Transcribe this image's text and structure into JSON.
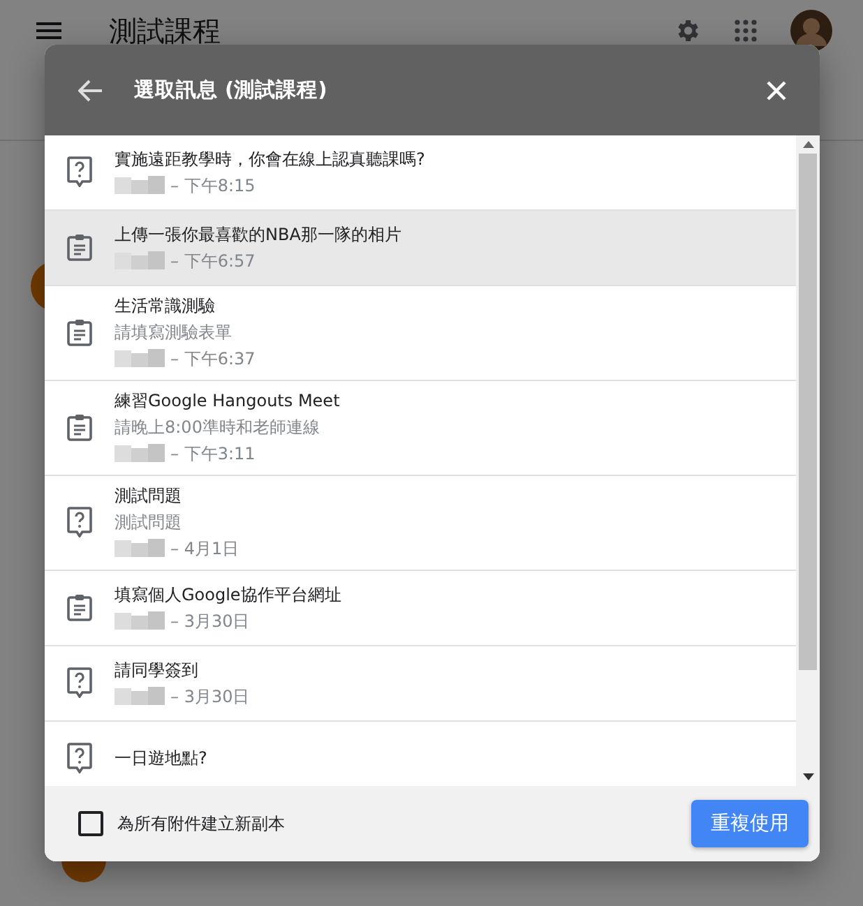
{
  "page": {
    "title": "測試課程"
  },
  "dialog": {
    "title": "選取訊息 (測試課程)",
    "items": [
      {
        "kind": "question",
        "title": "實施遠距教學時，你會在線上認真聽課嗎?",
        "time": "– 下午8:15",
        "selected": false
      },
      {
        "kind": "assignment",
        "title": "上傳一張你最喜歡的NBA那一隊的相片",
        "time": "– 下午6:57",
        "selected": true
      },
      {
        "kind": "assignment",
        "title": "生活常識測驗",
        "subtitle": "請填寫測驗表單",
        "time": "– 下午6:37",
        "selected": false
      },
      {
        "kind": "assignment",
        "title": "練習Google Hangouts Meet",
        "subtitle": "請晚上8:00準時和老師連線",
        "time": "– 下午3:11",
        "selected": false
      },
      {
        "kind": "question",
        "title": "測試問題",
        "subtitle": "測試問題",
        "time": "– 4月1日",
        "selected": false
      },
      {
        "kind": "assignment",
        "title": "填寫個人Google協作平台網址",
        "time": "– 3月30日",
        "selected": false
      },
      {
        "kind": "question",
        "title": "請同學簽到",
        "time": "– 3月30日",
        "selected": false
      },
      {
        "kind": "question",
        "title": "一日遊地點?",
        "selected": false
      }
    ],
    "copy_option": {
      "label": "為所有附件建立新副本",
      "checked": false
    },
    "button": "重複使用"
  }
}
